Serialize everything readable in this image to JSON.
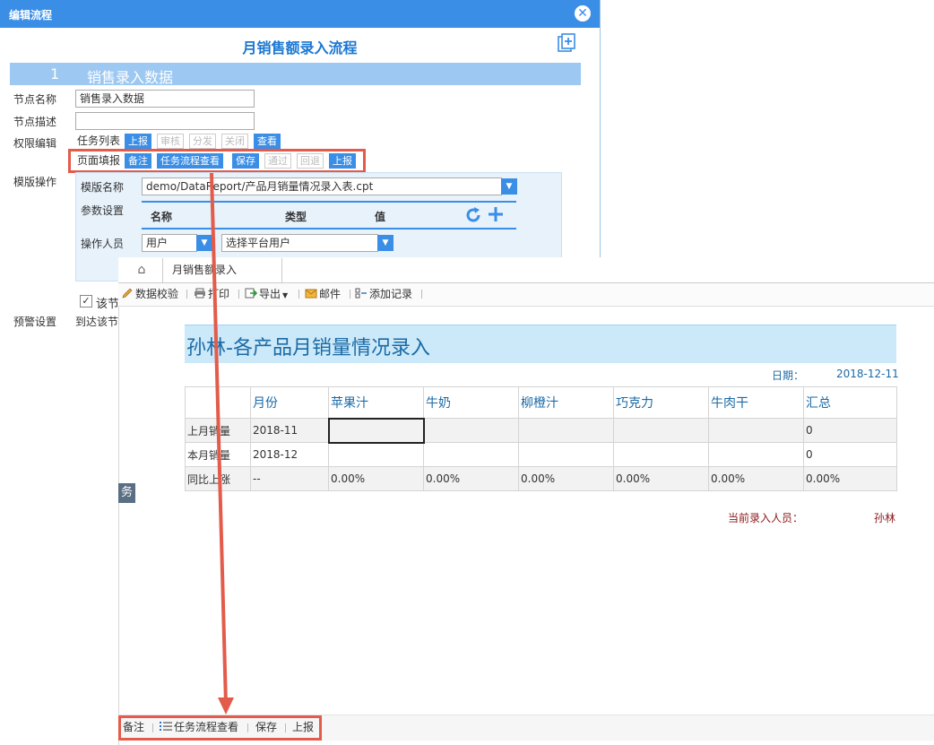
{
  "dialog": {
    "title": "编辑流程",
    "close_icon": "✕",
    "flow_name": "月销售额录入流程",
    "node_number": "1",
    "node_title": "销售录入数据",
    "labels": {
      "node_name": "节点名称",
      "node_desc": "节点描述",
      "permission": "权限编辑",
      "template_op": "模版操作",
      "warning": "预警设置"
    },
    "node_name_value": "销售录入数据",
    "node_desc_value": "",
    "perm_row1": {
      "label": "任务列表",
      "buttons": [
        {
          "label": "上报",
          "active": true
        },
        {
          "label": "审核",
          "active": false
        },
        {
          "label": "分发",
          "active": false
        },
        {
          "label": "关闭",
          "active": false
        },
        {
          "label": "查看",
          "active": true
        }
      ]
    },
    "perm_row2": {
      "label": "页面填报",
      "buttons": [
        {
          "label": "备注",
          "active": true
        },
        {
          "label": "任务流程查看",
          "active": true
        },
        {
          "label": "保存",
          "active": true
        },
        {
          "label": "通过",
          "active": false
        },
        {
          "label": "回退",
          "active": false
        },
        {
          "label": "上报",
          "active": true
        }
      ]
    },
    "template": {
      "name_label": "模版名称",
      "name_value": "demo/DataReport/产品月销量情况录入表.cpt",
      "param_label": "参数设置",
      "param_cols": [
        "名称",
        "类型",
        "值"
      ],
      "operator_label": "操作人员",
      "operator_type": "用户",
      "operator_select": "选择平台用户"
    },
    "checkbox_label": "该节",
    "warning_text": "到达该节"
  },
  "report": {
    "tab_label": "月销售额录入",
    "toolbar": [
      {
        "label": "数据校验",
        "icon": "pencil-icon"
      },
      {
        "label": "打印",
        "icon": "printer-icon"
      },
      {
        "label": "导出",
        "icon": "export-icon"
      },
      {
        "label": "邮件",
        "icon": "mail-icon"
      },
      {
        "label": "添加记录",
        "icon": "add-record-icon"
      }
    ],
    "title": "孙林-各产品月销量情况录入",
    "date_label": "日期：",
    "date_value": "2018-12-11",
    "table": {
      "headers": [
        "",
        "月份",
        "苹果汁",
        "牛奶",
        "柳橙汁",
        "巧克力",
        "牛肉干",
        "汇总"
      ],
      "rows": [
        [
          "上月销量",
          "2018-11",
          "",
          "",
          "",
          "",
          "",
          "0"
        ],
        [
          "本月销量",
          "2018-12",
          "",
          "",
          "",
          "",
          "",
          "0"
        ],
        [
          "同比上涨",
          "--",
          "0.00%",
          "0.00%",
          "0.00%",
          "0.00%",
          "0.00%",
          "0.00%"
        ]
      ]
    },
    "current_user_label": "当前录入人员：",
    "current_user_value": "孙林",
    "side_tag": "务",
    "bottom_bar": [
      {
        "label": "备注",
        "icon": ""
      },
      {
        "label": "任务流程查看",
        "icon": "list-icon"
      },
      {
        "label": "保存",
        "icon": ""
      },
      {
        "label": "上报",
        "icon": ""
      }
    ]
  },
  "colors": {
    "accent": "#3a8ee6",
    "highlight": "#e35b4a",
    "title_band": "#cce9f9",
    "user_text": "#8b1a1a"
  }
}
